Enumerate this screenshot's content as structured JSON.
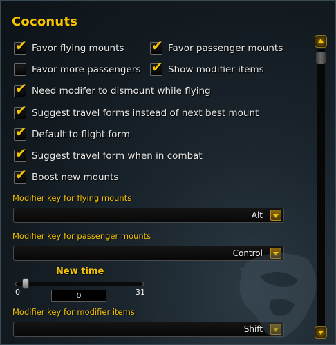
{
  "title": "Coconuts",
  "checkboxes": [
    {
      "label": "Favor flying mounts",
      "checked": true
    },
    {
      "label": "Favor passenger mounts",
      "checked": true
    },
    {
      "label": "Favor more passengers",
      "checked": false
    },
    {
      "label": "Show modifier items",
      "checked": true
    },
    {
      "label": "Need modifer to dismount while flying",
      "checked": true
    },
    {
      "label": "Suggest travel forms instead of next best mount",
      "checked": true
    },
    {
      "label": "Default to flight form",
      "checked": true
    },
    {
      "label": "Suggest travel form when in combat",
      "checked": true
    },
    {
      "label": "Boost new mounts",
      "checked": true
    }
  ],
  "dropdowns": [
    {
      "label": "Modifier key for flying mounts",
      "value": "Alt"
    },
    {
      "label": "Modifier key for passenger mounts",
      "value": "Control"
    },
    {
      "label": "Modifier key for modifier items",
      "value": "Shift"
    }
  ],
  "slider": {
    "title": "New time",
    "min": "0",
    "max": "31",
    "value": "0"
  },
  "colors": {
    "accent": "#f5c400",
    "text": "#e8e8e8",
    "background": "#1b252d"
  },
  "icons": {
    "check": "✔",
    "scroll_up": "arrow-up-icon",
    "scroll_down": "arrow-down-icon",
    "dropdown": "chevron-down-icon"
  }
}
